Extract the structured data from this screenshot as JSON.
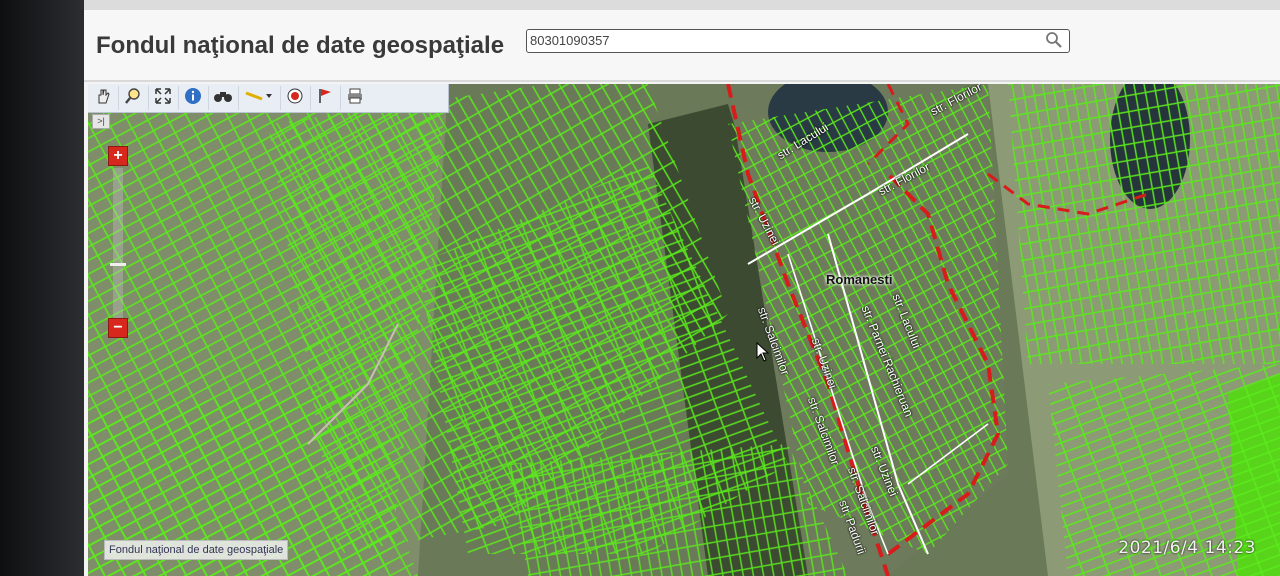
{
  "header": {
    "title": "Fondul naţional de date geospaţiale",
    "search_value": "80301090357"
  },
  "toolbar": {
    "tools": [
      {
        "name": "pan-icon"
      },
      {
        "name": "zoom-box-icon"
      },
      {
        "name": "full-extent-icon"
      },
      {
        "name": "info-icon"
      },
      {
        "name": "binoculars-icon"
      },
      {
        "name": "measure-icon"
      },
      {
        "name": "target-icon"
      },
      {
        "name": "flag-icon"
      },
      {
        "name": "print-icon"
      }
    ]
  },
  "map": {
    "collapse_label": ">|",
    "zoom_in_label": "+",
    "zoom_out_label": "−",
    "footer_label": "Fondul naţional de date geospaţiale",
    "town_label": "Romanesti",
    "street_labels": [
      "str. Lacului",
      "str. Florilor",
      "str. Uzinei",
      "str. Lacului",
      "str. Salcimilor",
      "str. Uzinei",
      "str. Parnei Rachieruan",
      "str. Salcimilor",
      "str. Uzinei",
      "str. Salcimilor",
      "str. Padurii",
      "str. Florilor"
    ],
    "colors": {
      "parcel": "#5bea1c",
      "boundary": "#d81c1c",
      "road": "#ffffff"
    }
  },
  "photo": {
    "timestamp": "2021/6/4 14:23"
  }
}
